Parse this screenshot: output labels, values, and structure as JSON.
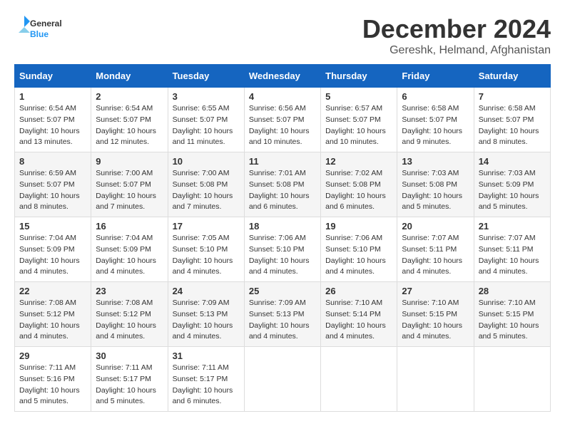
{
  "header": {
    "logo_general": "General",
    "logo_blue": "Blue",
    "month_title": "December 2024",
    "location": "Gereshk, Helmand, Afghanistan"
  },
  "days_of_week": [
    "Sunday",
    "Monday",
    "Tuesday",
    "Wednesday",
    "Thursday",
    "Friday",
    "Saturday"
  ],
  "weeks": [
    [
      {
        "day": "1",
        "sunrise": "6:54 AM",
        "sunset": "5:07 PM",
        "daylight": "10 hours and 13 minutes."
      },
      {
        "day": "2",
        "sunrise": "6:54 AM",
        "sunset": "5:07 PM",
        "daylight": "10 hours and 12 minutes."
      },
      {
        "day": "3",
        "sunrise": "6:55 AM",
        "sunset": "5:07 PM",
        "daylight": "10 hours and 11 minutes."
      },
      {
        "day": "4",
        "sunrise": "6:56 AM",
        "sunset": "5:07 PM",
        "daylight": "10 hours and 10 minutes."
      },
      {
        "day": "5",
        "sunrise": "6:57 AM",
        "sunset": "5:07 PM",
        "daylight": "10 hours and 10 minutes."
      },
      {
        "day": "6",
        "sunrise": "6:58 AM",
        "sunset": "5:07 PM",
        "daylight": "10 hours and 9 minutes."
      },
      {
        "day": "7",
        "sunrise": "6:58 AM",
        "sunset": "5:07 PM",
        "daylight": "10 hours and 8 minutes."
      }
    ],
    [
      {
        "day": "8",
        "sunrise": "6:59 AM",
        "sunset": "5:07 PM",
        "daylight": "10 hours and 8 minutes."
      },
      {
        "day": "9",
        "sunrise": "7:00 AM",
        "sunset": "5:07 PM",
        "daylight": "10 hours and 7 minutes."
      },
      {
        "day": "10",
        "sunrise": "7:00 AM",
        "sunset": "5:08 PM",
        "daylight": "10 hours and 7 minutes."
      },
      {
        "day": "11",
        "sunrise": "7:01 AM",
        "sunset": "5:08 PM",
        "daylight": "10 hours and 6 minutes."
      },
      {
        "day": "12",
        "sunrise": "7:02 AM",
        "sunset": "5:08 PM",
        "daylight": "10 hours and 6 minutes."
      },
      {
        "day": "13",
        "sunrise": "7:03 AM",
        "sunset": "5:08 PM",
        "daylight": "10 hours and 5 minutes."
      },
      {
        "day": "14",
        "sunrise": "7:03 AM",
        "sunset": "5:09 PM",
        "daylight": "10 hours and 5 minutes."
      }
    ],
    [
      {
        "day": "15",
        "sunrise": "7:04 AM",
        "sunset": "5:09 PM",
        "daylight": "10 hours and 4 minutes."
      },
      {
        "day": "16",
        "sunrise": "7:04 AM",
        "sunset": "5:09 PM",
        "daylight": "10 hours and 4 minutes."
      },
      {
        "day": "17",
        "sunrise": "7:05 AM",
        "sunset": "5:10 PM",
        "daylight": "10 hours and 4 minutes."
      },
      {
        "day": "18",
        "sunrise": "7:06 AM",
        "sunset": "5:10 PM",
        "daylight": "10 hours and 4 minutes."
      },
      {
        "day": "19",
        "sunrise": "7:06 AM",
        "sunset": "5:10 PM",
        "daylight": "10 hours and 4 minutes."
      },
      {
        "day": "20",
        "sunrise": "7:07 AM",
        "sunset": "5:11 PM",
        "daylight": "10 hours and 4 minutes."
      },
      {
        "day": "21",
        "sunrise": "7:07 AM",
        "sunset": "5:11 PM",
        "daylight": "10 hours and 4 minutes."
      }
    ],
    [
      {
        "day": "22",
        "sunrise": "7:08 AM",
        "sunset": "5:12 PM",
        "daylight": "10 hours and 4 minutes."
      },
      {
        "day": "23",
        "sunrise": "7:08 AM",
        "sunset": "5:12 PM",
        "daylight": "10 hours and 4 minutes."
      },
      {
        "day": "24",
        "sunrise": "7:09 AM",
        "sunset": "5:13 PM",
        "daylight": "10 hours and 4 minutes."
      },
      {
        "day": "25",
        "sunrise": "7:09 AM",
        "sunset": "5:13 PM",
        "daylight": "10 hours and 4 minutes."
      },
      {
        "day": "26",
        "sunrise": "7:10 AM",
        "sunset": "5:14 PM",
        "daylight": "10 hours and 4 minutes."
      },
      {
        "day": "27",
        "sunrise": "7:10 AM",
        "sunset": "5:15 PM",
        "daylight": "10 hours and 4 minutes."
      },
      {
        "day": "28",
        "sunrise": "7:10 AM",
        "sunset": "5:15 PM",
        "daylight": "10 hours and 5 minutes."
      }
    ],
    [
      {
        "day": "29",
        "sunrise": "7:11 AM",
        "sunset": "5:16 PM",
        "daylight": "10 hours and 5 minutes."
      },
      {
        "day": "30",
        "sunrise": "7:11 AM",
        "sunset": "5:17 PM",
        "daylight": "10 hours and 5 minutes."
      },
      {
        "day": "31",
        "sunrise": "7:11 AM",
        "sunset": "5:17 PM",
        "daylight": "10 hours and 6 minutes."
      },
      null,
      null,
      null,
      null
    ]
  ],
  "labels": {
    "sunrise": "Sunrise:",
    "sunset": "Sunset:",
    "daylight": "Daylight:"
  }
}
